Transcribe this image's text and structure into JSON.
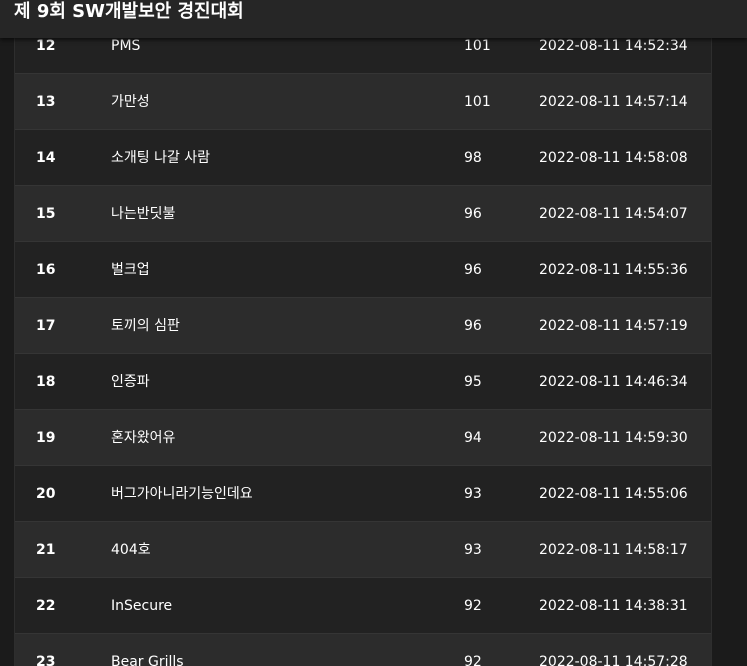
{
  "header": {
    "title": "제 9회 SW개발보안 경진대회"
  },
  "scoreboard": {
    "rows": [
      {
        "rank": "12",
        "team": "PMS",
        "score": "101",
        "time": "2022-08-11 14:52:34"
      },
      {
        "rank": "13",
        "team": "가만성",
        "score": "101",
        "time": "2022-08-11 14:57:14"
      },
      {
        "rank": "14",
        "team": "소개팅 나갈 사람",
        "score": "98",
        "time": "2022-08-11 14:58:08"
      },
      {
        "rank": "15",
        "team": "나는반딧불",
        "score": "96",
        "time": "2022-08-11 14:54:07"
      },
      {
        "rank": "16",
        "team": "벌크업",
        "score": "96",
        "time": "2022-08-11 14:55:36"
      },
      {
        "rank": "17",
        "team": "토끼의 심판",
        "score": "96",
        "time": "2022-08-11 14:57:19"
      },
      {
        "rank": "18",
        "team": "인증파",
        "score": "95",
        "time": "2022-08-11 14:46:34"
      },
      {
        "rank": "19",
        "team": "혼자왔어유",
        "score": "94",
        "time": "2022-08-11 14:59:30"
      },
      {
        "rank": "20",
        "team": "버그가아니라기능인데요",
        "score": "93",
        "time": "2022-08-11 14:55:06"
      },
      {
        "rank": "21",
        "team": "404호",
        "score": "93",
        "time": "2022-08-11 14:58:17"
      },
      {
        "rank": "22",
        "team": "InSecure",
        "score": "92",
        "time": "2022-08-11 14:38:31"
      },
      {
        "rank": "23",
        "team": "Bear Grills",
        "score": "92",
        "time": "2022-08-11 14:57:28"
      }
    ]
  }
}
